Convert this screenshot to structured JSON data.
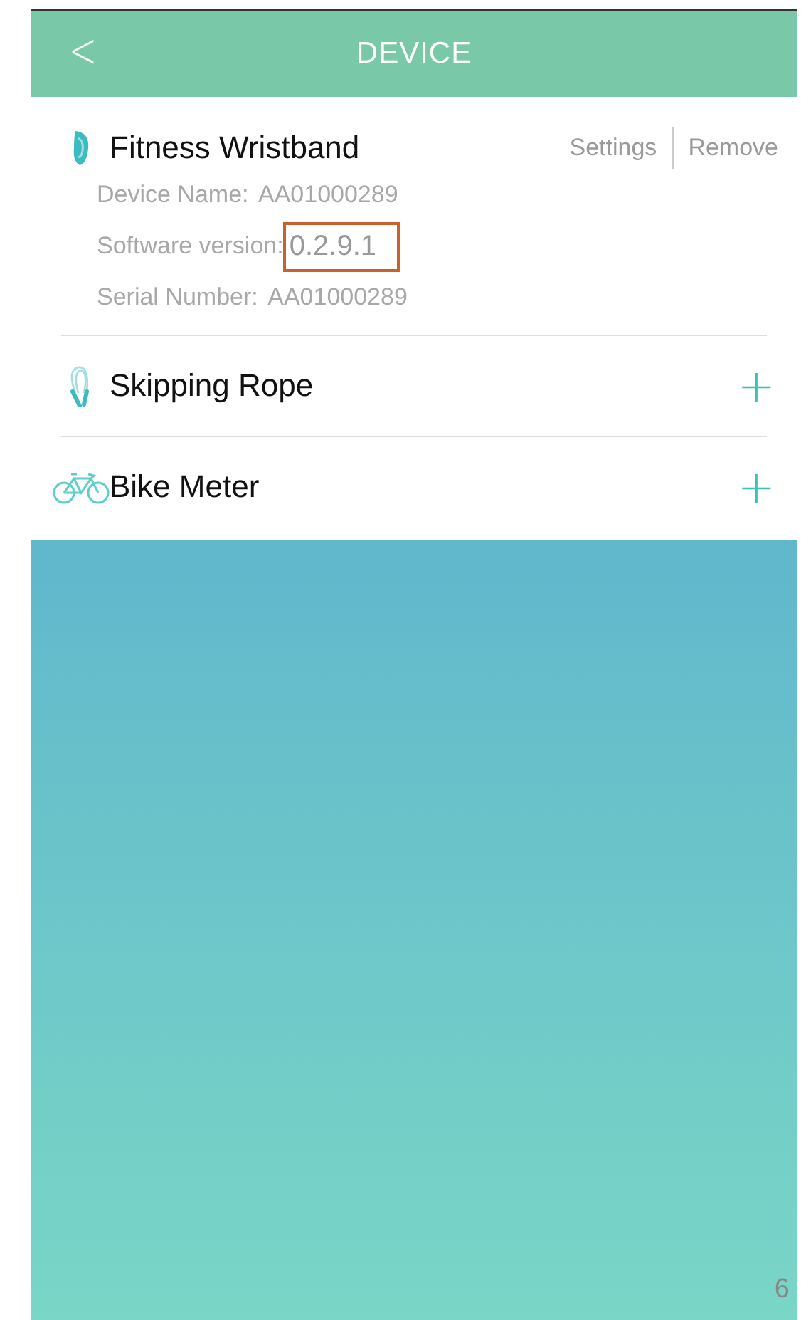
{
  "header": {
    "back": "<",
    "title": "DEVICE"
  },
  "devices": [
    {
      "kind": "connected",
      "name": "Fitness Wristband",
      "actions": [
        "Settings",
        "Remove"
      ],
      "details": [
        {
          "label": "Device Name: ",
          "value": "AA01000289",
          "highlighted": false
        },
        {
          "label": "Software version:",
          "value": "0.2.9.1",
          "highlighted": true
        },
        {
          "label": "Serial Number: ",
          "value": "AA01000289",
          "highlighted": false
        }
      ]
    },
    {
      "kind": "available",
      "name": "Skipping Rope",
      "add": "+"
    },
    {
      "kind": "available",
      "name": "Bike Meter",
      "add": "+"
    }
  ],
  "page_number": "6"
}
